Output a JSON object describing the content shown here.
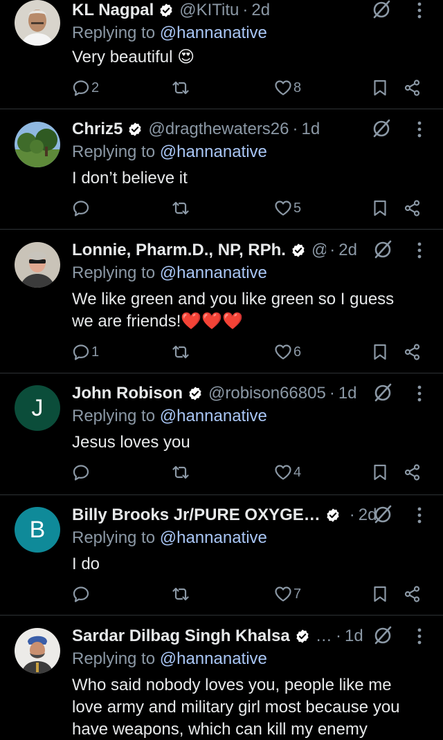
{
  "posts": [
    {
      "name": "KL Nagpal",
      "handle": "@KITitu",
      "time": "2d",
      "reply_prefix": "Replying to",
      "reply_to": "@hannanative",
      "text": "Very  beautiful 😍",
      "replies": "2",
      "likes": "8",
      "avatar": "photo-man-white-shirt"
    },
    {
      "name": "Chriz5",
      "handle": "@dragthewaters26",
      "time": "1d",
      "reply_prefix": "Replying to",
      "reply_to": "@hannanative",
      "text": "I don’t believe it",
      "replies": "",
      "likes": "5",
      "avatar": "photo-trees-landscape"
    },
    {
      "name": "Lonnie, Pharm.D., NP, RPh.",
      "handle": "@…",
      "time": "2d",
      "reply_prefix": "Replying to",
      "reply_to": "@hannanative",
      "text": "We like green and you like green so I guess we are friends!❤️❤️❤️",
      "replies": "1",
      "likes": "6",
      "avatar": "photo-man-sunglasses"
    },
    {
      "name": "John Robison",
      "handle": "@robison66805",
      "time": "1d",
      "reply_prefix": "Replying to",
      "reply_to": "@hannanative",
      "text": "Jesus loves you",
      "replies": "",
      "likes": "4",
      "avatar_letter": "J",
      "avatar_color": "#0b4d3a"
    },
    {
      "name": "Billy Brooks Jr/PURE OXYGE…",
      "handle": "",
      "time": "2d",
      "reply_prefix": "Replying to",
      "reply_to": "@hannanative",
      "text": "I do",
      "replies": "",
      "likes": "7",
      "avatar_letter": "B",
      "avatar_color": "#0f8a99"
    },
    {
      "name": "Sardar Dilbag Singh Khalsa",
      "handle": "…",
      "time": "1d",
      "reply_prefix": "Replying to",
      "reply_to": "@hannanative",
      "text": "Who said nobody loves you, people like me love army and military girl most because you have weapons, which can kill my enemy",
      "avatar": "photo-man-turban"
    }
  ],
  "colors": {
    "background": "#000000",
    "text": "#e7e9ea",
    "muted": "#8b98a5",
    "mention": "#a9c6f5",
    "verified": "#ffffff",
    "divider": "#2f3336"
  },
  "icons": [
    "verified-badge-icon",
    "grok-icon",
    "more-icon",
    "reply-icon",
    "repost-icon",
    "like-icon",
    "bookmark-icon",
    "share-icon"
  ]
}
